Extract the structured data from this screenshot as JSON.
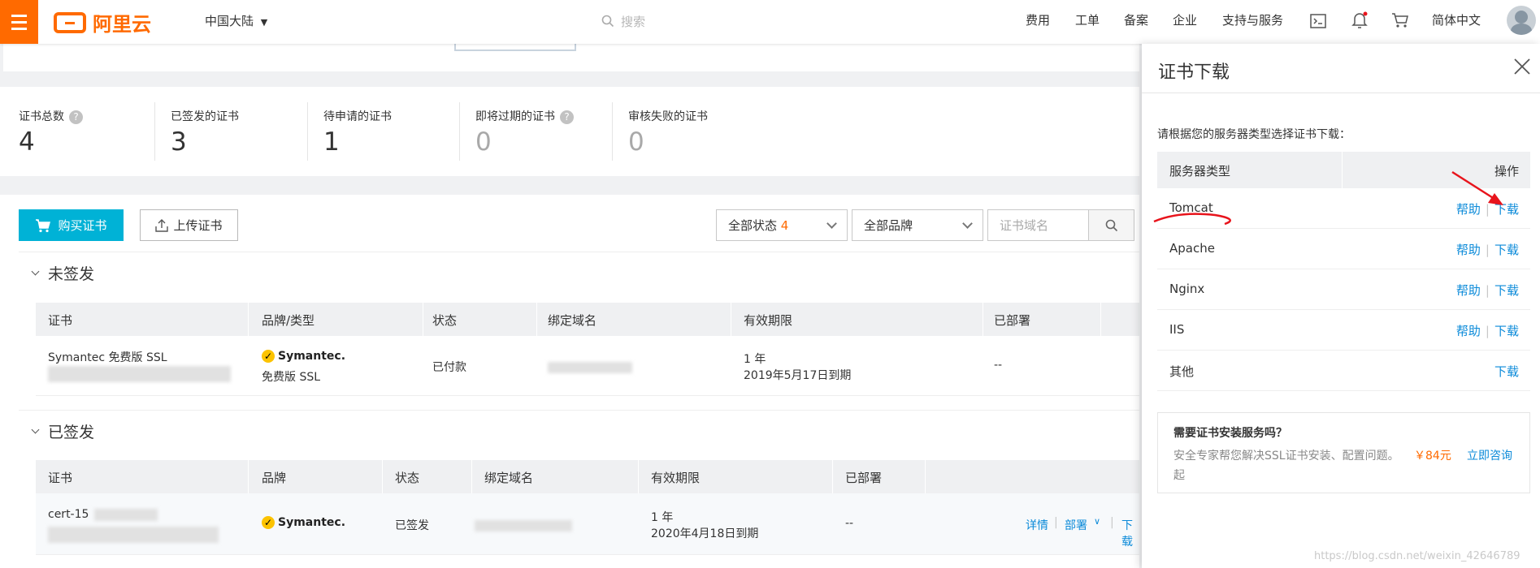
{
  "topbar": {
    "logo_text": "阿里云",
    "region": "中国大陆",
    "search_placeholder": "搜索",
    "nav": [
      "费用",
      "工单",
      "备案",
      "企业",
      "支持与服务"
    ],
    "language": "简体中文"
  },
  "stats": [
    {
      "label": "证书总数",
      "value": "4",
      "help": true
    },
    {
      "label": "已签发的证书",
      "value": "3",
      "help": false
    },
    {
      "label": "待申请的证书",
      "value": "1",
      "help": false
    },
    {
      "label": "即将过期的证书",
      "value": "0",
      "help": true
    },
    {
      "label": "审核失败的证书",
      "value": "0",
      "help": false
    }
  ],
  "toolbar": {
    "buy_label": "购买证书",
    "upload_label": "上传证书",
    "status_filter": "全部状态",
    "status_count": "4",
    "brand_filter": "全部品牌",
    "domain_placeholder": "证书域名"
  },
  "unissued": {
    "title": "未签发",
    "headers": [
      "证书",
      "品牌/类型",
      "状态",
      "绑定域名",
      "有效期限",
      "已部署"
    ],
    "row": {
      "cert": "Symantec 免费版 SSL",
      "brand": "Symantec.",
      "type": "免费版 SSL",
      "status": "已付款",
      "validity_line1": "1 年",
      "validity_line2": "2019年5月17日到期",
      "deployed": "--"
    }
  },
  "issued": {
    "title": "已签发",
    "headers": [
      "证书",
      "品牌",
      "状态",
      "绑定域名",
      "有效期限",
      "已部署"
    ],
    "row": {
      "cert": "cert-15",
      "brand": "Symantec.",
      "status": "已签发",
      "validity_line1": "1 年",
      "validity_line2": "2020年4月18日到期",
      "deployed": "--",
      "action_detail": "详情",
      "action_deploy": "部署",
      "action_download": "下载"
    }
  },
  "drawer": {
    "title": "证书下载",
    "instruction": "请根据您的服务器类型选择证书下载：",
    "col_server": "服务器类型",
    "col_action": "操作",
    "rows": [
      {
        "name": "Tomcat",
        "help": "帮助",
        "download": "下载"
      },
      {
        "name": "Apache",
        "help": "帮助",
        "download": "下载"
      },
      {
        "name": "Nginx",
        "help": "帮助",
        "download": "下载"
      },
      {
        "name": "IIS",
        "help": "帮助",
        "download": "下载"
      },
      {
        "name": "其他",
        "help": "",
        "download": "下载"
      }
    ],
    "promo_title": "需要证书安装服务吗？",
    "promo_text": "安全专家帮您解决SSL证书安装、配置问题。",
    "promo_price": "￥84元",
    "promo_suffix": "起",
    "promo_link": "立即咨询"
  },
  "watermark": "https://blog.csdn.net/weixin_42646789",
  "colors": {
    "brand": "#ff6a00",
    "primary": "#00b2d6",
    "link": "#0b8ad9",
    "annotation": "#e8141c"
  }
}
